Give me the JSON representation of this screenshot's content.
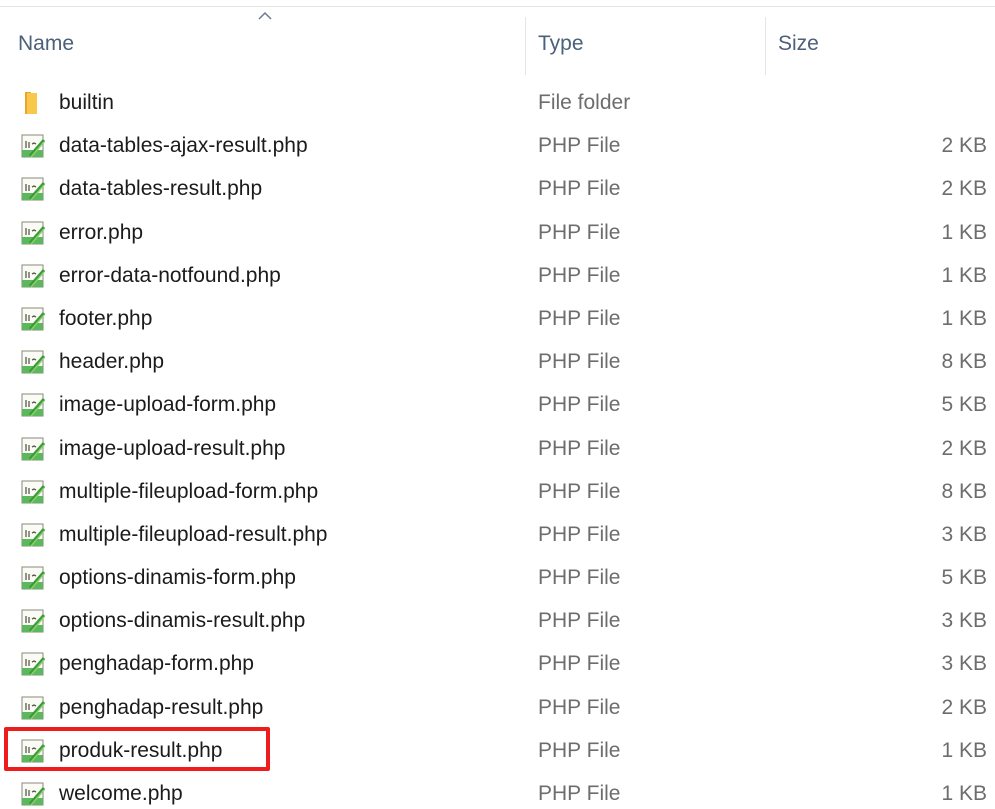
{
  "header": {
    "name_label": "Name",
    "type_label": "Type",
    "size_label": "Size",
    "sort_icon": "chevron-up-icon"
  },
  "files": [
    {
      "name": "builtin",
      "type": "File folder",
      "size": "",
      "icon": "folder-icon"
    },
    {
      "name": "data-tables-ajax-result.php",
      "type": "PHP File",
      "size": "2 KB",
      "icon": "php-file-icon"
    },
    {
      "name": "data-tables-result.php",
      "type": "PHP File",
      "size": "2 KB",
      "icon": "php-file-icon"
    },
    {
      "name": "error.php",
      "type": "PHP File",
      "size": "1 KB",
      "icon": "php-file-icon"
    },
    {
      "name": "error-data-notfound.php",
      "type": "PHP File",
      "size": "1 KB",
      "icon": "php-file-icon"
    },
    {
      "name": "footer.php",
      "type": "PHP File",
      "size": "1 KB",
      "icon": "php-file-icon"
    },
    {
      "name": "header.php",
      "type": "PHP File",
      "size": "8 KB",
      "icon": "php-file-icon"
    },
    {
      "name": "image-upload-form.php",
      "type": "PHP File",
      "size": "5 KB",
      "icon": "php-file-icon"
    },
    {
      "name": "image-upload-result.php",
      "type": "PHP File",
      "size": "2 KB",
      "icon": "php-file-icon"
    },
    {
      "name": "multiple-fileupload-form.php",
      "type": "PHP File",
      "size": "8 KB",
      "icon": "php-file-icon"
    },
    {
      "name": "multiple-fileupload-result.php",
      "type": "PHP File",
      "size": "3 KB",
      "icon": "php-file-icon"
    },
    {
      "name": "options-dinamis-form.php",
      "type": "PHP File",
      "size": "5 KB",
      "icon": "php-file-icon"
    },
    {
      "name": "options-dinamis-result.php",
      "type": "PHP File",
      "size": "3 KB",
      "icon": "php-file-icon"
    },
    {
      "name": "penghadap-form.php",
      "type": "PHP File",
      "size": "3 KB",
      "icon": "php-file-icon"
    },
    {
      "name": "penghadap-result.php",
      "type": "PHP File",
      "size": "2 KB",
      "icon": "php-file-icon"
    },
    {
      "name": "produk-result.php",
      "type": "PHP File",
      "size": "1 KB",
      "icon": "php-file-icon",
      "highlighted": true
    },
    {
      "name": "welcome.php",
      "type": "PHP File",
      "size": "1 KB",
      "icon": "php-file-icon"
    }
  ],
  "colors": {
    "highlight_border": "#ee1c1c",
    "header_text": "#4c607a",
    "secondary_text": "#6d6d6d",
    "folder": "#f8c84a",
    "php_icon_green": "#4caf50"
  }
}
